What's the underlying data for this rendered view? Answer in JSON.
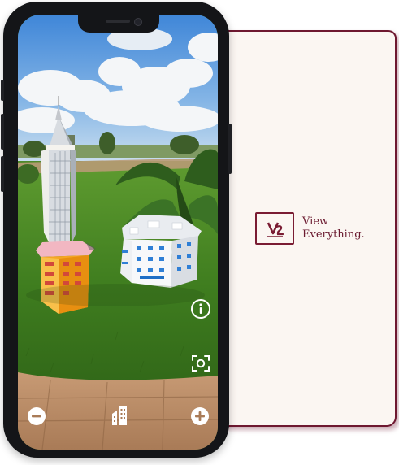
{
  "splash": {
    "brand_line1": "View",
    "brand_line2": "Everything.",
    "accent": "#6e1830"
  },
  "ar_view": {
    "controls": [
      "info-icon",
      "capture-icon",
      "zoom-out-icon",
      "building-icon",
      "zoom-in-icon"
    ],
    "button_color": "#ffffff"
  }
}
